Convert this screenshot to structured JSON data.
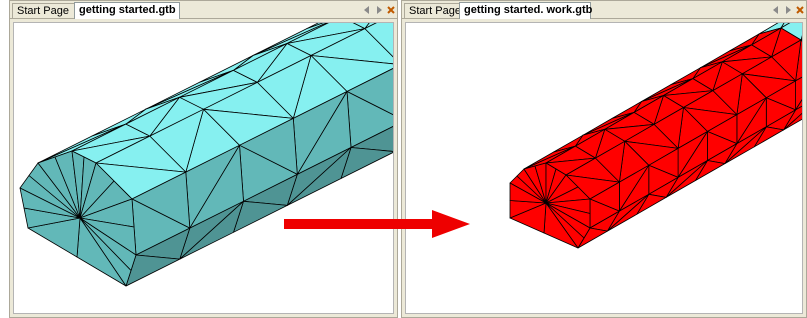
{
  "left_panel": {
    "tabs": [
      {
        "label": "Start Page",
        "active": false
      },
      {
        "label": "getting started.gtb",
        "active": true
      }
    ]
  },
  "right_panel": {
    "tabs": [
      {
        "label": "Start Page",
        "active": false
      },
      {
        "label": "getting started. work.gtb",
        "active": true
      }
    ]
  },
  "colors": {
    "mesh_top": "#86f0f0",
    "mesh_front": "#62b8b8",
    "mesh_side": "#4f9494",
    "selection": "#ff0000",
    "arrow": "#ee0000",
    "tab_bar": "#ece9d8",
    "close_icon": "#c05a00"
  },
  "icons": {
    "nav_prev": "arrow-left-icon",
    "nav_next": "arrow-right-icon",
    "close": "close-icon"
  }
}
